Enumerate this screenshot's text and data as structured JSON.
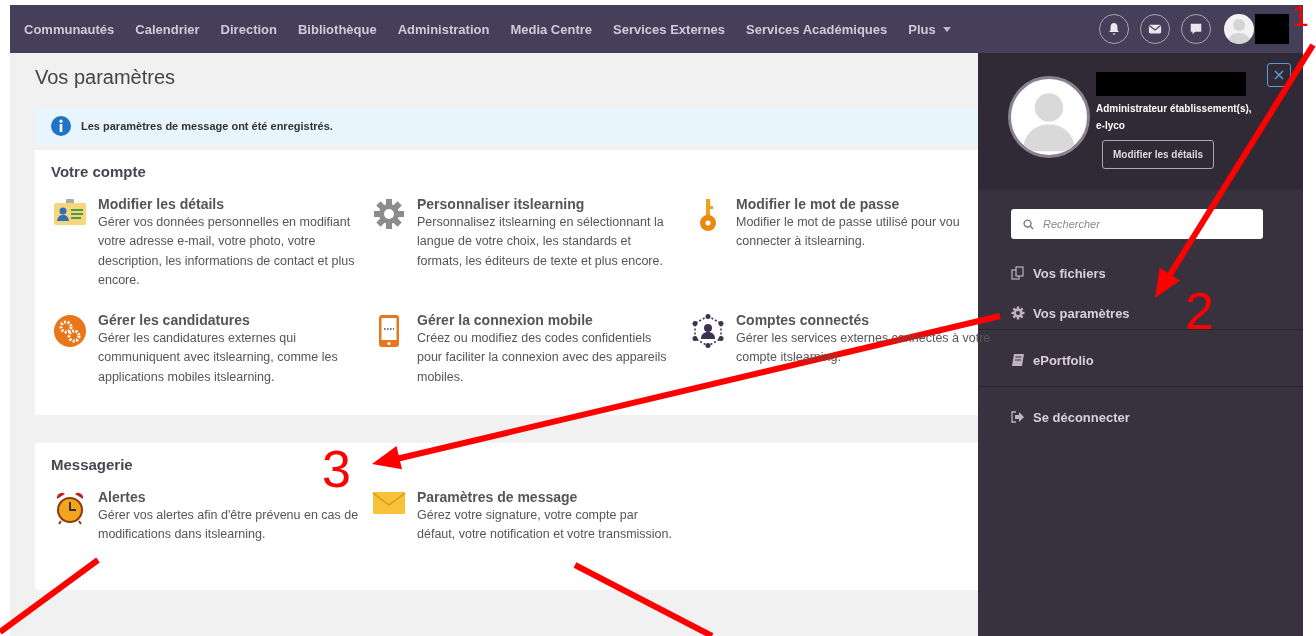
{
  "nav": {
    "items": [
      "Communautés",
      "Calendrier",
      "Direction",
      "Bibliothèque",
      "Administration",
      "Media Centre",
      "Services Externes",
      "Services Académiques"
    ],
    "more": "Plus"
  },
  "page_title": "Vos paramètres",
  "notice": "Les paramètres de message ont été enregistrés.",
  "sections": [
    {
      "title": "Votre compte",
      "items": [
        {
          "title": "Modifier les détails",
          "desc": "Gérer vos données personnelles en modifiant votre adresse e-mail, votre photo, votre description, les informations de contact et plus encore."
        },
        {
          "title": "Personnaliser itslearning",
          "desc": "Personnalisez itslearning en sélectionnant la langue de votre choix, les standards et formats, les éditeurs de texte et plus encore."
        },
        {
          "title": "Modifier le mot de passe",
          "desc": "Modifier le mot de passe utilisé pour vou\nconnecter à itslearning."
        },
        {
          "title": "Gérer les candidatures",
          "desc": "Gérer les candidatures externes qui communiquent avec itslearning, comme les applications mobiles itslearning."
        },
        {
          "title": "Gérer la connexion mobile",
          "desc": "Créez ou modifiez des codes confidentiels pour faciliter la connexion avec des appareils mobiles."
        },
        {
          "title": "Comptes connectés",
          "desc": "Gérer les services externes connectés à votre compte itslearning."
        }
      ]
    },
    {
      "title": "Messagerie",
      "items": [
        {
          "title": "Alertes",
          "desc": "Gérer vos alertes afin d'être prévenu en cas de modifications dans itslearning."
        },
        {
          "title": "Paramètres de message",
          "desc": "Gérez votre signature, votre compte par défaut, votre notification et votre transmission."
        }
      ]
    }
  ],
  "panel": {
    "role_lines": [
      "Administrateur établissement(s),",
      "e-lyco"
    ],
    "edit_button": "Modifier les détails",
    "search_placeholder": "Rechercher",
    "menu_groups": [
      [
        {
          "label": "Vos fichiers"
        },
        {
          "label": "Vos paramètres"
        }
      ],
      [
        {
          "label": "ePortfolio"
        }
      ],
      [
        {
          "label": "Se déconnecter"
        }
      ]
    ]
  },
  "annotations": [
    "1",
    "2",
    "3"
  ]
}
